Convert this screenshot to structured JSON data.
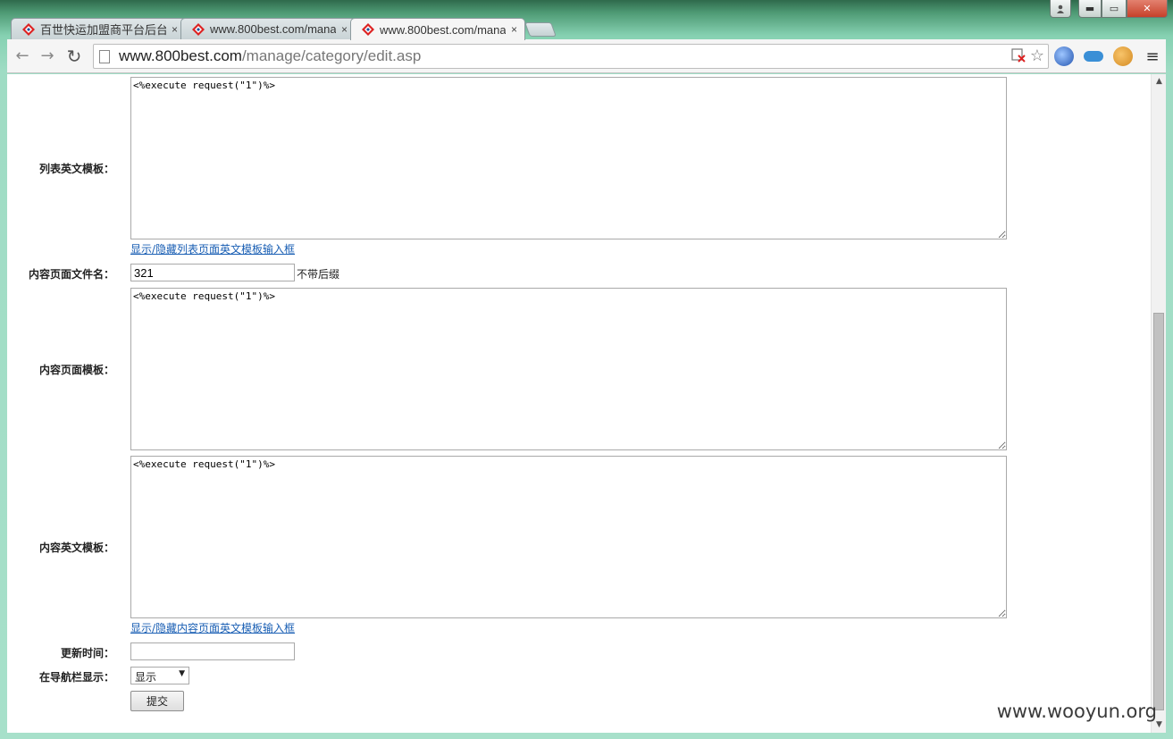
{
  "tabs": [
    {
      "title": "百世快运加盟商平台后台",
      "active": false
    },
    {
      "title": "www.800best.com/mana",
      "active": false
    },
    {
      "title": "www.800best.com/mana",
      "active": true
    }
  ],
  "tab_close": "×",
  "window_buttons": {
    "minimize": "▬",
    "maximize": "▭",
    "close": "✕"
  },
  "nav": {
    "back": "←",
    "forward": "→",
    "reload": "↻"
  },
  "address": {
    "host": "www.800best.com",
    "path": "/manage/category/edit.asp"
  },
  "icons": {
    "blocked": "blocked-content-icon",
    "star": "☆",
    "menu": "≡"
  },
  "form": {
    "list_en_template": {
      "label": "列表英文模板：",
      "value": "<%execute request(\"1\")%>",
      "toggle_link": "显示/隐藏列表页面英文模板输入框"
    },
    "content_filename": {
      "label": "内容页面文件名：",
      "value": "321",
      "suffix": "不带后缀"
    },
    "content_template": {
      "label": "内容页面模板：",
      "value": "<%execute request(\"1\")%>"
    },
    "content_en_template": {
      "label": "内容英文模板：",
      "value": "<%execute request(\"1\")%>",
      "toggle_link": "显示/隐藏内容页面英文模板输入框"
    },
    "update_time": {
      "label": "更新时间：",
      "value": ""
    },
    "show_in_nav": {
      "label": "在导航栏显示：",
      "selected": "显示"
    },
    "submit_label": "提交"
  },
  "watermark": "www.wooyun.org",
  "colors": {
    "link": "#1a5fb4",
    "close_button": "#c7402a",
    "frame": "#86d1b2"
  }
}
